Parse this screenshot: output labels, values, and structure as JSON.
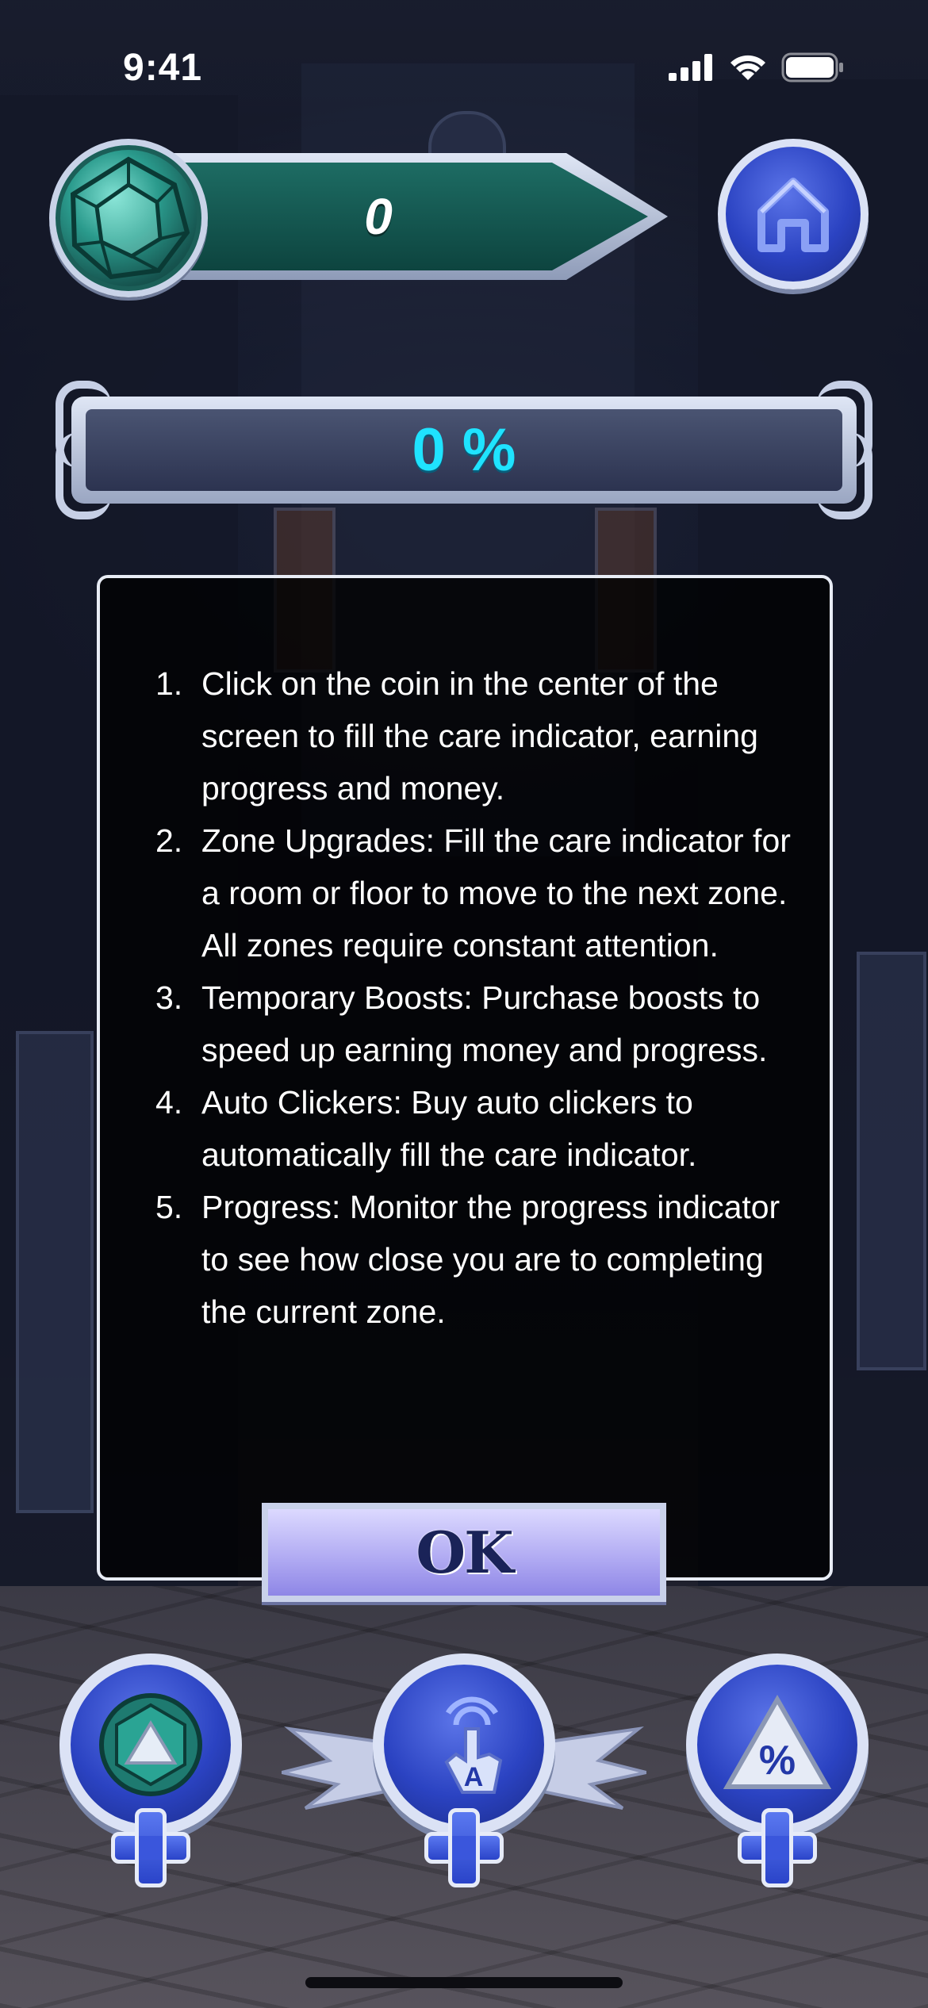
{
  "status_bar": {
    "time": "9:41"
  },
  "header": {
    "coin_count": "0"
  },
  "progress": {
    "display": "0 %",
    "percent": 0
  },
  "instructions": {
    "items": [
      {
        "number": "1.",
        "text": "Click on the coin in the center of the screen to fill the care indicator, earning progress and money."
      },
      {
        "number": "2.",
        "text": "Zone Upgrades: Fill the care indicator for a room or floor to move to the next zone. All zones require constant attention."
      },
      {
        "number": "3.",
        "text": "Temporary Boosts: Purchase boosts to speed up earning money and progress."
      },
      {
        "number": "4.",
        "text": "Auto Clickers: Buy auto clickers to automatically fill the care indicator."
      },
      {
        "number": "5.",
        "text": "Progress: Monitor the progress indicator to see how close you are to completing the current zone."
      }
    ],
    "ok_label": "OK"
  },
  "shop_buttons": [
    {
      "icon": "coin-upgrade-icon"
    },
    {
      "icon": "auto-clicker-icon",
      "icon_letter": "A"
    },
    {
      "icon": "percent-boost-icon",
      "icon_text": "%"
    }
  ],
  "colors": {
    "progress_text": "#1fe3ff",
    "banner_teal": "#0f4a45",
    "button_blue": "#2b43c2"
  }
}
